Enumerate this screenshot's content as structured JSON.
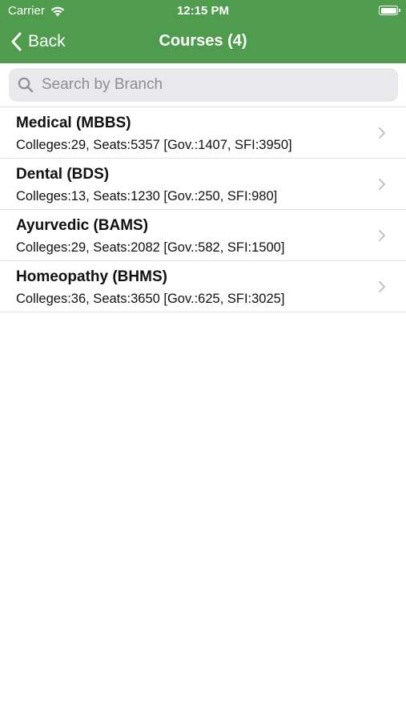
{
  "status_bar": {
    "carrier": "Carrier",
    "time": "12:15 PM",
    "wifi_icon": "wifi-icon",
    "battery_icon": "battery-icon"
  },
  "nav": {
    "back_label": "Back",
    "title": "Courses (4)",
    "bar_color": "#4f9c4f"
  },
  "search": {
    "placeholder": "Search by Branch",
    "value": "",
    "icon": "search-icon"
  },
  "courses": [
    {
      "name": "Medical (MBBS)",
      "detail": "Colleges:29, Seats:5357 [Gov.:1407, SFI:3950]"
    },
    {
      "name": "Dental (BDS)",
      "detail": "Colleges:13, Seats:1230 [Gov.:250, SFI:980]"
    },
    {
      "name": "Ayurvedic (BAMS)",
      "detail": "Colleges:29, Seats:2082 [Gov.:582, SFI:1500]"
    },
    {
      "name": "Homeopathy (BHMS)",
      "detail": "Colleges:36, Seats:3650 [Gov.:625, SFI:3025]"
    }
  ]
}
